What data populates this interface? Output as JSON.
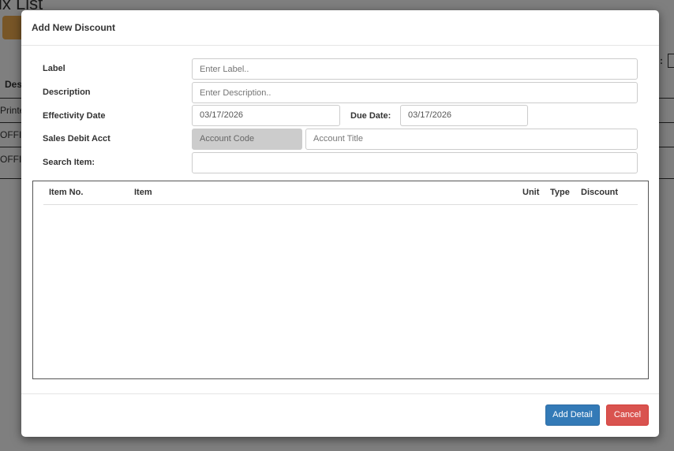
{
  "background": {
    "title": "ix List",
    "column_header": "Desc",
    "rows": [
      "Printe",
      "OFFIC",
      "OFFIC"
    ],
    "label_fragment": ":"
  },
  "modal": {
    "title": "Add New Discount",
    "fields": {
      "label": {
        "label": "Label",
        "placeholder": "Enter Label.."
      },
      "description": {
        "label": "Description",
        "placeholder": "Enter Description.."
      },
      "effectivity_date": {
        "label": "Effectivity Date",
        "value": "03/17/2026"
      },
      "due_date": {
        "label": "Due Date:",
        "value": "03/17/2026"
      },
      "sales_debit_acct": {
        "label": "Sales Debit Acct",
        "code_placeholder": "Account Code",
        "title_placeholder": "Account Title"
      },
      "search_item": {
        "label": "Search Item:",
        "value": ""
      }
    },
    "table": {
      "columns": [
        "Item No.",
        "Item",
        "Unit",
        "Type",
        "Discount"
      ],
      "rows": []
    },
    "buttons": {
      "add_detail": "Add Detail",
      "cancel": "Cancel"
    },
    "colors": {
      "primary": "#337ab7",
      "danger": "#d9534f"
    }
  }
}
